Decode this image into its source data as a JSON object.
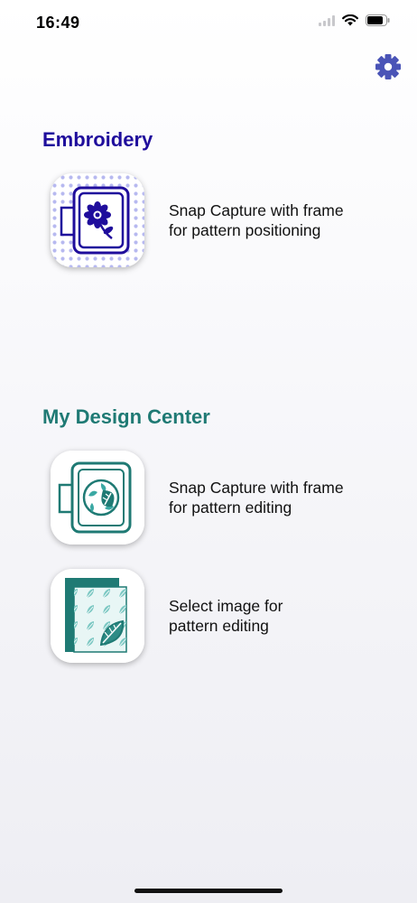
{
  "status_bar": {
    "time": "16:49",
    "icons": [
      "signal-icon",
      "wifi-icon",
      "battery-icon"
    ]
  },
  "header": {
    "settings_icon": "gear-icon"
  },
  "colors": {
    "embroidery_accent": "#1f0d9c",
    "design_accent": "#1f7a74",
    "settings_icon": "#4a54b7"
  },
  "sections": [
    {
      "title": "Embroidery",
      "items": [
        {
          "icon": "embroidery-frame-flower-icon",
          "line1": "Snap Capture with frame",
          "line2": "for pattern positioning"
        }
      ]
    },
    {
      "title": "My Design Center",
      "items": [
        {
          "icon": "design-frame-leaf-icon",
          "line1": "Snap Capture with frame",
          "line2": "for pattern editing"
        },
        {
          "icon": "image-leaf-pattern-icon",
          "line1": "Select image for",
          "line2": "pattern editing"
        }
      ]
    }
  ]
}
